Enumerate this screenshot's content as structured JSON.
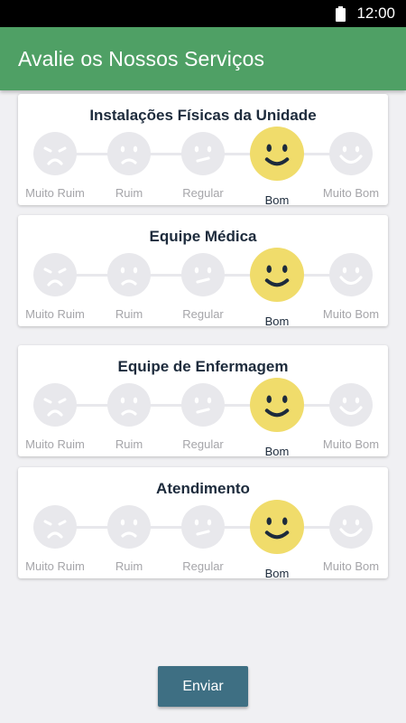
{
  "status_bar": {
    "time": "12:00",
    "battery_icon": "battery-full-icon"
  },
  "app_bar": {
    "title": "Avalie os Nossos Serviços",
    "color": "#4fa065"
  },
  "rating_options": [
    {
      "label": "Muito Ruim",
      "icon": "very-sad-face-icon"
    },
    {
      "label": "Ruim",
      "icon": "sad-face-icon"
    },
    {
      "label": "Regular",
      "icon": "neutral-face-icon"
    },
    {
      "label": "Bom",
      "icon": "smile-face-icon"
    },
    {
      "label": "Muito Bom",
      "icon": "big-smile-face-icon"
    }
  ],
  "categories": [
    {
      "title": "Instalações Físicas da Unidade",
      "selected": "Bom"
    },
    {
      "title": "Equipe Médica",
      "selected": "Bom"
    },
    {
      "title": "Equipe de Enfermagem",
      "selected": "Bom"
    },
    {
      "title": "Atendimento",
      "selected": "Bom"
    }
  ],
  "colors": {
    "selected_face": "#f0dc6b",
    "inactive_face": "#e8e8ec",
    "submit_button": "#3e6f83"
  },
  "submit_button": {
    "label": "Enviar"
  }
}
